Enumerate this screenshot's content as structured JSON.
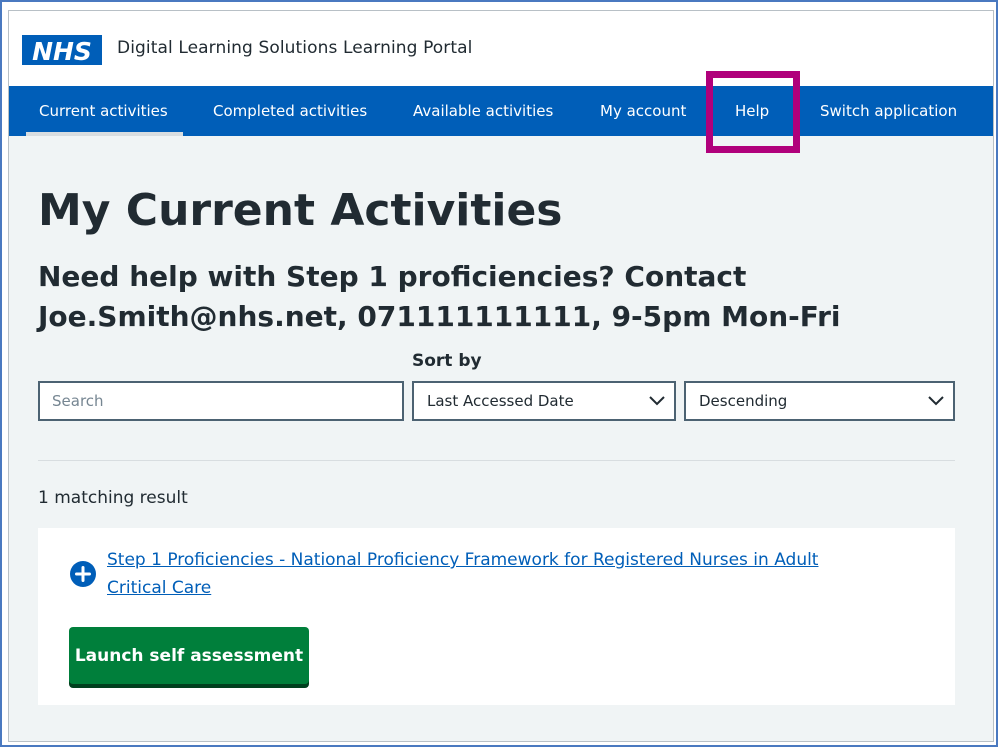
{
  "header": {
    "logo_text": "NHS",
    "service_name": "Digital Learning Solutions Learning Portal"
  },
  "nav": {
    "items": [
      {
        "label": "Current activities",
        "active": true
      },
      {
        "label": "Completed activities",
        "active": false
      },
      {
        "label": "Available activities",
        "active": false
      },
      {
        "label": "My account",
        "active": false
      },
      {
        "label": "Help",
        "active": false,
        "highlighted": true
      },
      {
        "label": "Switch application",
        "active": false
      }
    ]
  },
  "main": {
    "title": "My Current Activities",
    "help_line_1": "Need help with Step 1 proficiencies? Contact",
    "help_line_2": "Joe.Smith@nhs.net, 071111111111, 9-5pm Mon-Fri",
    "search": {
      "placeholder": "Search",
      "value": ""
    },
    "sort": {
      "label": "Sort by",
      "field_value": "Last Accessed Date",
      "direction_value": "Descending"
    },
    "result_count": "1 matching result",
    "results": [
      {
        "title_line_1": "Step 1 Proficiencies - National Proficiency Framework for Registered Nurses in Adult",
        "title_line_2": "Critical Care",
        "action_label": "Launch self assessment",
        "expand_icon": "plus-circle-icon"
      }
    ]
  },
  "colors": {
    "nhs_blue": "#005eb8",
    "highlight": "#b0007b",
    "button_green": "#007f3b",
    "page_background": "#f0f4f5",
    "text": "#212b32"
  }
}
